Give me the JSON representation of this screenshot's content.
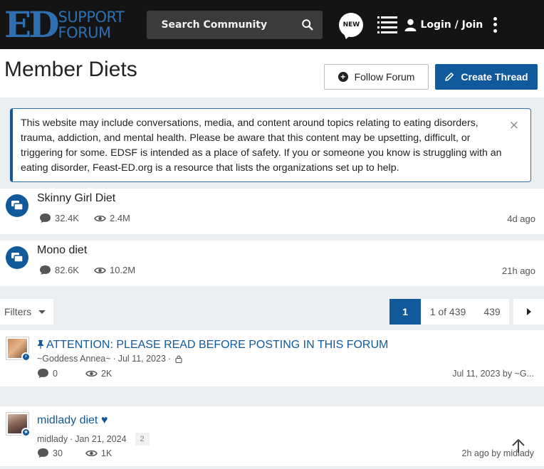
{
  "header": {
    "logo_mark": "ED",
    "logo_line1": "SUPPORT",
    "logo_line2": "FORUM",
    "search_label": "Search Community",
    "new_badge": "NEW",
    "login_label": "Login / Join"
  },
  "page": {
    "title": "Member Diets",
    "follow_label": "Follow Forum",
    "create_label": "Create Thread"
  },
  "notice": {
    "text": "This website may include conversations, media, and content around topics relating to eating disorders, trauma, addiction, and mental health. Please be aware that this content may be upsetting, difficult, or triggering for some. EDSF is intended as a place of safety. If you or someone you know is struggling with an eating disorder, Feast-ED.org is a resource that lists the organizations set up to help.",
    "close_glyph": "×"
  },
  "sticky_forums": [
    {
      "title": "Skinny Girl Diet",
      "replies": "32.4K",
      "views": "2.4M",
      "time": "4d ago"
    },
    {
      "title": "Mono diet",
      "replies": "82.6K",
      "views": "10.2M",
      "time": "21h ago"
    }
  ],
  "filters": {
    "label": "Filters"
  },
  "pagination": {
    "current": "1",
    "of_label": "1 of 439",
    "last": "439"
  },
  "threads": [
    {
      "title": "ATTENTION: PLEASE READ BEFORE POSTING IN THIS FORUM",
      "pinned": true,
      "author": "~Goddess Annea~",
      "date": "Jul 11, 2023",
      "replies": "0",
      "views": "2K",
      "last": "Jul 11, 2023 by ~G..."
    },
    {
      "title": "midlady diet ♥",
      "pinned": false,
      "author": "midlady",
      "date": "Jan 21, 2024",
      "pages": "2",
      "replies": "30",
      "views": "1K",
      "last": "2h ago by midlady"
    }
  ],
  "colors": {
    "brand": "#10599a",
    "logo": "#2e6fb1",
    "header_bg": "#141414"
  }
}
